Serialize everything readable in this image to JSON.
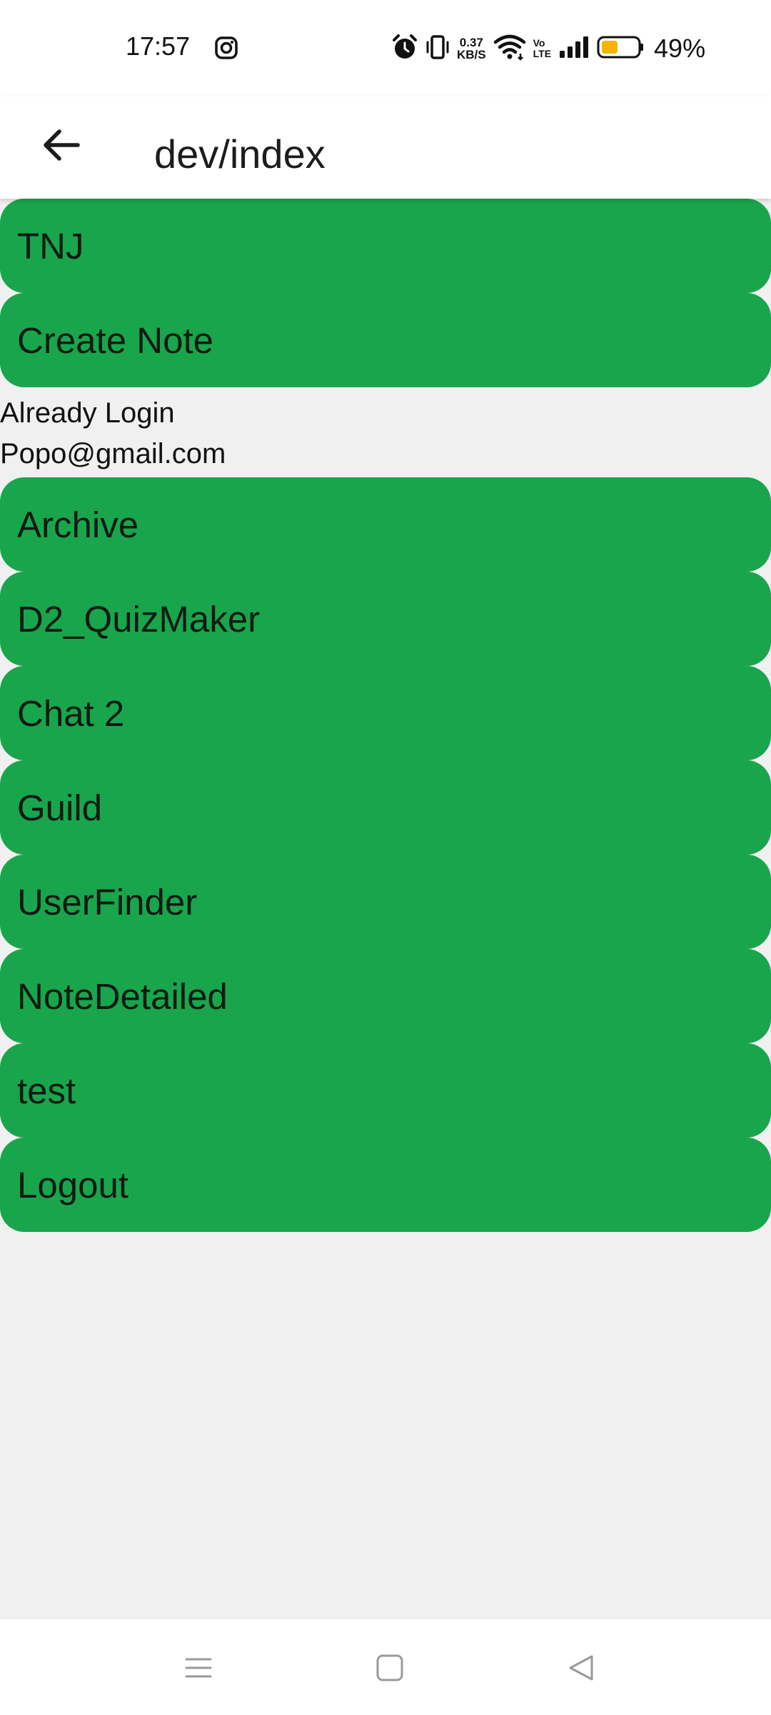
{
  "status_bar": {
    "time": "17:57",
    "net_speed_value": "0.37",
    "net_speed_unit": "KB/S",
    "volte_top": "Vo",
    "volte_bottom": "LTE",
    "battery_percent": "49%",
    "icons": [
      "instagram-icon",
      "alarm-icon",
      "vibrate-icon",
      "wifi-icon",
      "volte-icon",
      "signal-icon",
      "battery-icon"
    ]
  },
  "app_bar": {
    "title": "dev/index",
    "back_icon": "arrow-left-icon"
  },
  "menu_top": [
    {
      "label": "TNJ"
    },
    {
      "label": "Create Note"
    }
  ],
  "info": {
    "status": "Already Login",
    "email": "Popo@gmail.com"
  },
  "menu_bottom": [
    {
      "label": "Archive"
    },
    {
      "label": "D2_QuizMaker"
    },
    {
      "label": "Chat 2"
    },
    {
      "label": "Guild"
    },
    {
      "label": "UserFinder"
    },
    {
      "label": "NoteDetailed"
    },
    {
      "label": "test"
    },
    {
      "label": "Logout"
    }
  ],
  "nav_bar": {
    "icons": [
      "recents-menu-icon",
      "home-square-icon",
      "back-triangle-icon"
    ]
  },
  "colors": {
    "button_green": "#19a54c",
    "background": "#f0f0f0",
    "bar_white": "#ffffff"
  }
}
